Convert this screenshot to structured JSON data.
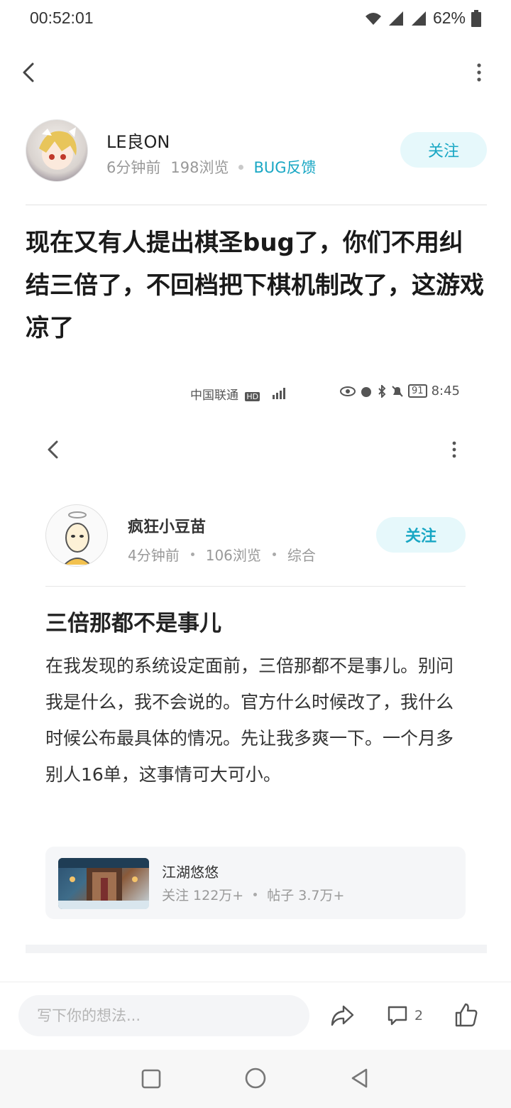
{
  "status_bar": {
    "time": "00:52:01",
    "battery": "62%"
  },
  "author": {
    "name": "LE良ON",
    "time_ago": "6分钟前",
    "views": "198浏览",
    "category": "BUG反馈",
    "follow_label": "关注"
  },
  "post": {
    "title": "现在又有人提出棋圣bug了，你们不用纠结三倍了，不回档把下棋机制改了，这游戏凉了"
  },
  "embedded": {
    "status_carrier": "中国联通",
    "status_time": "8:45",
    "battery": "91",
    "author_name": "疯狂小豆苗",
    "time_ago": "4分钟前",
    "views": "106浏览",
    "category": "综合",
    "follow_label": "关注",
    "title": "三倍那都不是事儿",
    "body": "在我发现的系统设定面前，三倍那都不是事儿。别问我是什么，我不会说的。官方什么时候改了，我什么时候公布最具体的情况。先让我多爽一下。一个月多别人16单，这事情可大可小。",
    "forum_card": {
      "name": "江湖悠悠",
      "followers": "关注 122万+",
      "posts": "帖子 3.7万+"
    }
  },
  "comment_bar": {
    "placeholder": "写下你的想法...",
    "comment_count": "2"
  },
  "colors": {
    "accent": "#19a7c4",
    "follow_bg": "#e6f8fb"
  }
}
